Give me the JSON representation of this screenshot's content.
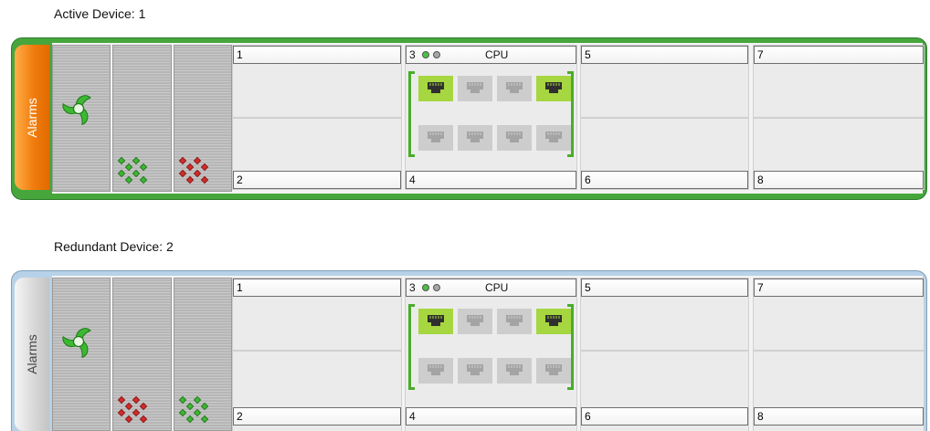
{
  "active_device": {
    "title": "Active Device: 1",
    "alarms_label": "Alarms",
    "fans": [
      {
        "icon": "fan-status-icon",
        "dots": null
      },
      {
        "icon": null,
        "dots": "green"
      },
      {
        "icon": null,
        "dots": "red"
      }
    ],
    "slots": {
      "s1": "1",
      "s2": "2",
      "s3": "3",
      "s4": "4",
      "s5": "5",
      "s6": "6",
      "s7": "7",
      "s8": "8"
    },
    "cpu_label": "CPU",
    "ports_top": [
      "active",
      "idle",
      "idle",
      "active"
    ],
    "ports_bottom": [
      "idle",
      "idle",
      "idle",
      "idle"
    ],
    "frame_color": "#46a63c",
    "tab_color": "#f07c0c"
  },
  "redundant_device": {
    "title": "Redundant Device: 2",
    "alarms_label": "Alarms",
    "fans": [
      {
        "icon": "fan-status-icon",
        "dots": null
      },
      {
        "icon": null,
        "dots": "red"
      },
      {
        "icon": null,
        "dots": "green"
      }
    ],
    "slots": {
      "s1": "1",
      "s2": "2",
      "s3": "3",
      "s4": "4",
      "s5": "5",
      "s6": "6",
      "s7": "7",
      "s8": "8"
    },
    "cpu_label": "CPU",
    "ports_top": [
      "active",
      "idle",
      "idle",
      "active"
    ],
    "ports_bottom": [
      "idle",
      "idle",
      "idle",
      "idle"
    ],
    "frame_color": "#b7d2e8",
    "tab_color": "#d6d6d6"
  }
}
